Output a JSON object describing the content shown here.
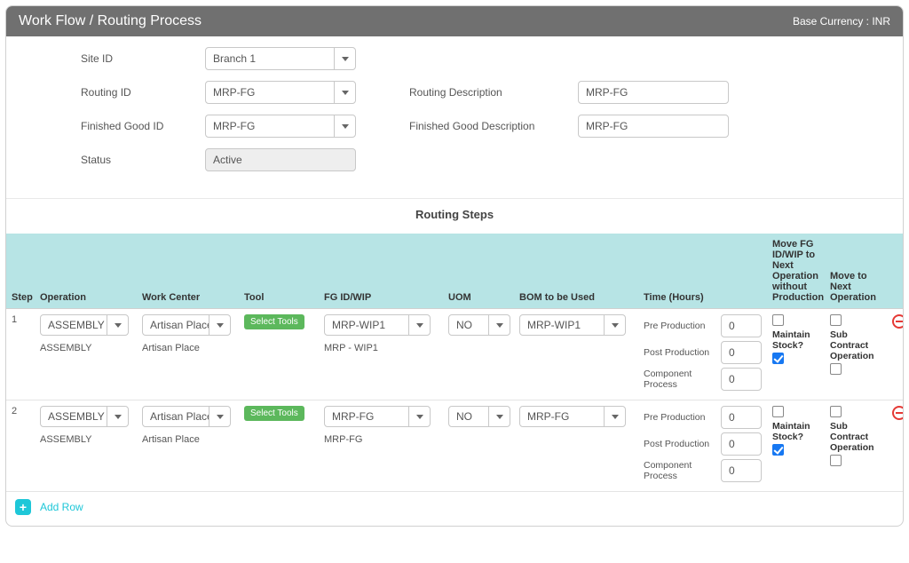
{
  "header": {
    "title": "Work Flow / Routing Process",
    "base_currency_label": "Base Currency : INR"
  },
  "form": {
    "labels": {
      "site_id": "Site ID",
      "routing_id": "Routing ID",
      "routing_desc": "Routing Description",
      "fg_id": "Finished Good ID",
      "fg_desc": "Finished Good Description",
      "status": "Status"
    },
    "values": {
      "site_id": "Branch 1",
      "routing_id": "MRP-FG",
      "routing_desc": "MRP-FG",
      "fg_id": "MRP-FG",
      "fg_desc": "MRP-FG",
      "status": "Active"
    }
  },
  "steps_title": "Routing Steps",
  "columns": {
    "step": "Step",
    "operation": "Operation",
    "work_center": "Work Center",
    "tool": "Tool",
    "fg_wip": "FG ID/WIP",
    "uom": "UOM",
    "bom": "BOM to be Used",
    "time": "Time (Hours)",
    "move_noprod": "Move FG ID/WIP to Next Operation without Production",
    "move_next": "Move to Next Operation"
  },
  "time_labels": {
    "pre": "Pre Production",
    "post": "Post Production",
    "comp": "Component Process"
  },
  "flag_labels": {
    "maintain_stock": "Maintain Stock?",
    "sub_contract": "Sub Contract Operation"
  },
  "select_tools_label": "Select Tools",
  "steps": [
    {
      "num": "1",
      "operation": "ASSEMBLY",
      "operation_text": "ASSEMBLY",
      "work_center": "Artisan Place",
      "work_center_text": "Artisan Place",
      "fg_wip": "MRP-WIP1",
      "fg_wip_text": "MRP - WIP1",
      "uom": "NO",
      "bom": "MRP-WIP1",
      "pre": "0",
      "post": "0",
      "comp": "0",
      "move_noprod": false,
      "maintain_stock": true,
      "move_next": false,
      "sub_contract": false
    },
    {
      "num": "2",
      "operation": "ASSEMBLY",
      "operation_text": "ASSEMBLY",
      "work_center": "Artisan Place",
      "work_center_text": "Artisan Place",
      "fg_wip": "MRP-FG",
      "fg_wip_text": "MRP-FG",
      "uom": "NO",
      "bom": "MRP-FG",
      "pre": "0",
      "post": "0",
      "comp": "0",
      "move_noprod": false,
      "maintain_stock": true,
      "move_next": false,
      "sub_contract": false
    }
  ],
  "footer": {
    "add_row": "Add Row"
  }
}
